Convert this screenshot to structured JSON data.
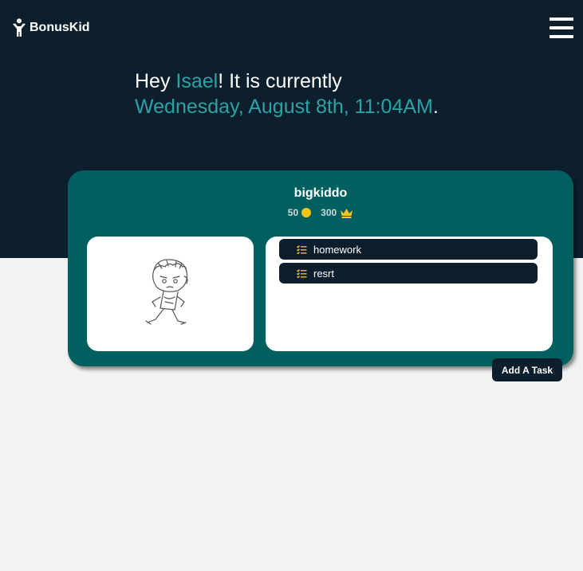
{
  "header": {
    "brand": "BonusKid",
    "logo_icon": "kid-figure-icon",
    "menu_icon": "hamburger-menu-icon"
  },
  "greeting": {
    "prefix": "Hey ",
    "name": "Isael",
    "middle": "! It is currently",
    "datetime": "Wednesday, August 8th, 11:04AM",
    "suffix": "."
  },
  "kid_card": {
    "name": "bigkiddo",
    "coins": "50",
    "coin_icon": "coin-icon",
    "crowns": "300",
    "crown_icon": "crown-icon",
    "avatar_icon": "sketch-kid-running-icon",
    "tasks": [
      {
        "label": "homework",
        "icon": "task-list-icon"
      },
      {
        "label": "resrt",
        "icon": "task-list-icon"
      }
    ]
  },
  "actions": {
    "add_task": "Add A Task"
  },
  "colors": {
    "navy": "#0d1f2d",
    "teal_card": "#006060",
    "accent": "#2aa3a6",
    "gold": "#f5c518",
    "page_bg": "#f2f2f2"
  }
}
